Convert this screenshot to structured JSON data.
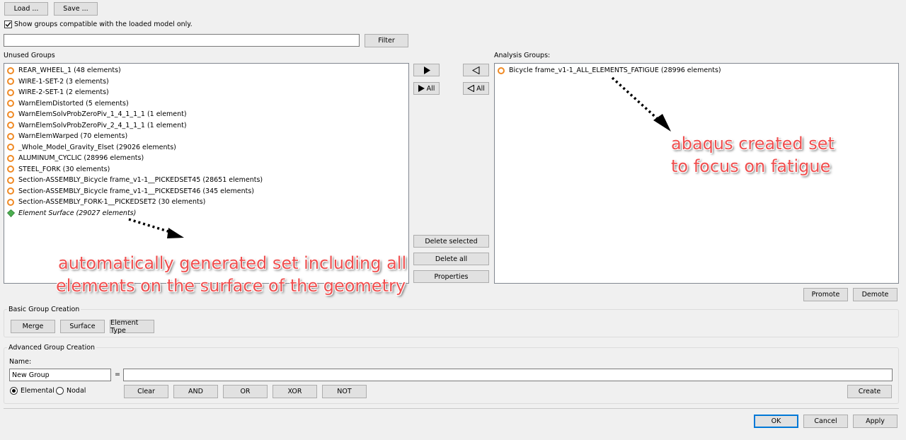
{
  "toolbar": {
    "load_label": "Load ...",
    "save_label": "Save ..."
  },
  "show_compatible": {
    "label": "Show groups compatible with the loaded model only.",
    "checked": true
  },
  "filter": {
    "value": "",
    "button_label": "Filter"
  },
  "unused": {
    "title": "Unused Groups",
    "items": [
      {
        "label": "REAR_WHEEL_1 (48 elements)",
        "icon": "orange-ring-icon"
      },
      {
        "label": "WIRE-1-SET-2 (3 elements)",
        "icon": "orange-ring-icon"
      },
      {
        "label": "WIRE-2-SET-1 (2 elements)",
        "icon": "orange-ring-icon"
      },
      {
        "label": "WarnElemDistorted (5 elements)",
        "icon": "orange-ring-icon"
      },
      {
        "label": "WarnElemSolvProbZeroPiv_1_4_1_1_1 (1 element)",
        "icon": "orange-ring-icon"
      },
      {
        "label": "WarnElemSolvProbZeroPiv_2_4_1_1_1 (1 element)",
        "icon": "orange-ring-icon"
      },
      {
        "label": "WarnElemWarped (70 elements)",
        "icon": "orange-ring-icon"
      },
      {
        "label": "_Whole_Model_Gravity_Elset (29026 elements)",
        "icon": "orange-ring-icon"
      },
      {
        "label": "ALUMINUM_CYCLIC (28996 elements)",
        "icon": "orange-ring-icon"
      },
      {
        "label": "STEEL_FORK (30 elements)",
        "icon": "orange-ring-icon"
      },
      {
        "label": "Section-ASSEMBLY_Bicycle frame_v1-1__PICKEDSET45 (28651 elements)",
        "icon": "orange-ring-icon"
      },
      {
        "label": "Section-ASSEMBLY_Bicycle frame_v1-1__PICKEDSET46 (345 elements)",
        "icon": "orange-ring-icon"
      },
      {
        "label": "Section-ASSEMBLY_FORK-1__PICKEDSET2 (30 elements)",
        "icon": "orange-ring-icon"
      },
      {
        "label": "Element Surface (29027 elements)",
        "icon": "green-gem-icon"
      }
    ]
  },
  "transfer": {
    "move_right_icon": "play-right-icon",
    "move_all_right_label": "All",
    "move_left_icon": "triangle-left-icon",
    "move_all_left_label": "All"
  },
  "analysis": {
    "title": "Analysis Groups:",
    "items": [
      {
        "label": "Bicycle frame_v1-1_ALL_ELEMENTS_FATIGUE (28996 elements)",
        "icon": "orange-ring-icon"
      }
    ]
  },
  "actions": {
    "delete_selected": "Delete selected",
    "delete_all": "Delete all",
    "properties": "Properties",
    "promote": "Promote",
    "demote": "Demote"
  },
  "basic": {
    "title": "Basic Group Creation",
    "merge": "Merge",
    "surface": "Surface",
    "element_type": "Element Type"
  },
  "advanced": {
    "title": "Advanced Group Creation",
    "name_label": "Name:",
    "name_value": "New Group",
    "equals": "=",
    "expression_value": "",
    "elemental_label": "Elemental",
    "nodal_label": "Nodal",
    "elemental_selected": true,
    "clear": "Clear",
    "and": "AND",
    "or": "OR",
    "xor": "XOR",
    "not": "NOT",
    "create": "Create"
  },
  "dialog": {
    "ok": "OK",
    "cancel": "Cancel",
    "apply": "Apply"
  },
  "annotations": {
    "left_line1": "automatically generated set including all",
    "left_line2": "elements on the surface of the geometry",
    "right_line1": "abaqus created set",
    "right_line2": "to focus on fatigue",
    "color": "#ef4f4f"
  }
}
